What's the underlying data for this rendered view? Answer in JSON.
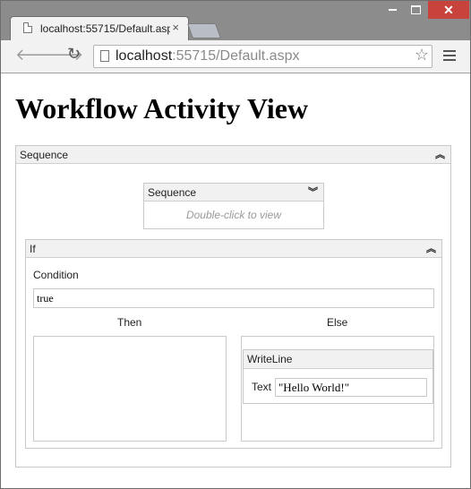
{
  "browser": {
    "tab_title": "localhost:55715/Default.aspx",
    "tab_close": "×",
    "url_host": "localhost",
    "url_rest": ":55715/Default.aspx",
    "window_close": "✕"
  },
  "page": {
    "title": "Workflow Activity View"
  },
  "sequence_outer": {
    "label": "Sequence",
    "chevron": "︽"
  },
  "sequence_inner": {
    "label": "Sequence",
    "chevron": "︾",
    "placeholder": "Double-click to view"
  },
  "if_activity": {
    "label": "If",
    "chevron": "︽",
    "condition_label": "Condition",
    "condition_value": "true",
    "then_label": "Then",
    "else_label": "Else"
  },
  "writeline": {
    "label": "WriteLine",
    "text_label": "Text",
    "text_value": "\"Hello World!\""
  },
  "icons": [
    "doc-icon",
    "back-arrow-icon",
    "forward-arrow-icon",
    "reload-icon",
    "page-icon",
    "star-icon",
    "menu-icon",
    "collapse-icon",
    "expand-icon"
  ]
}
